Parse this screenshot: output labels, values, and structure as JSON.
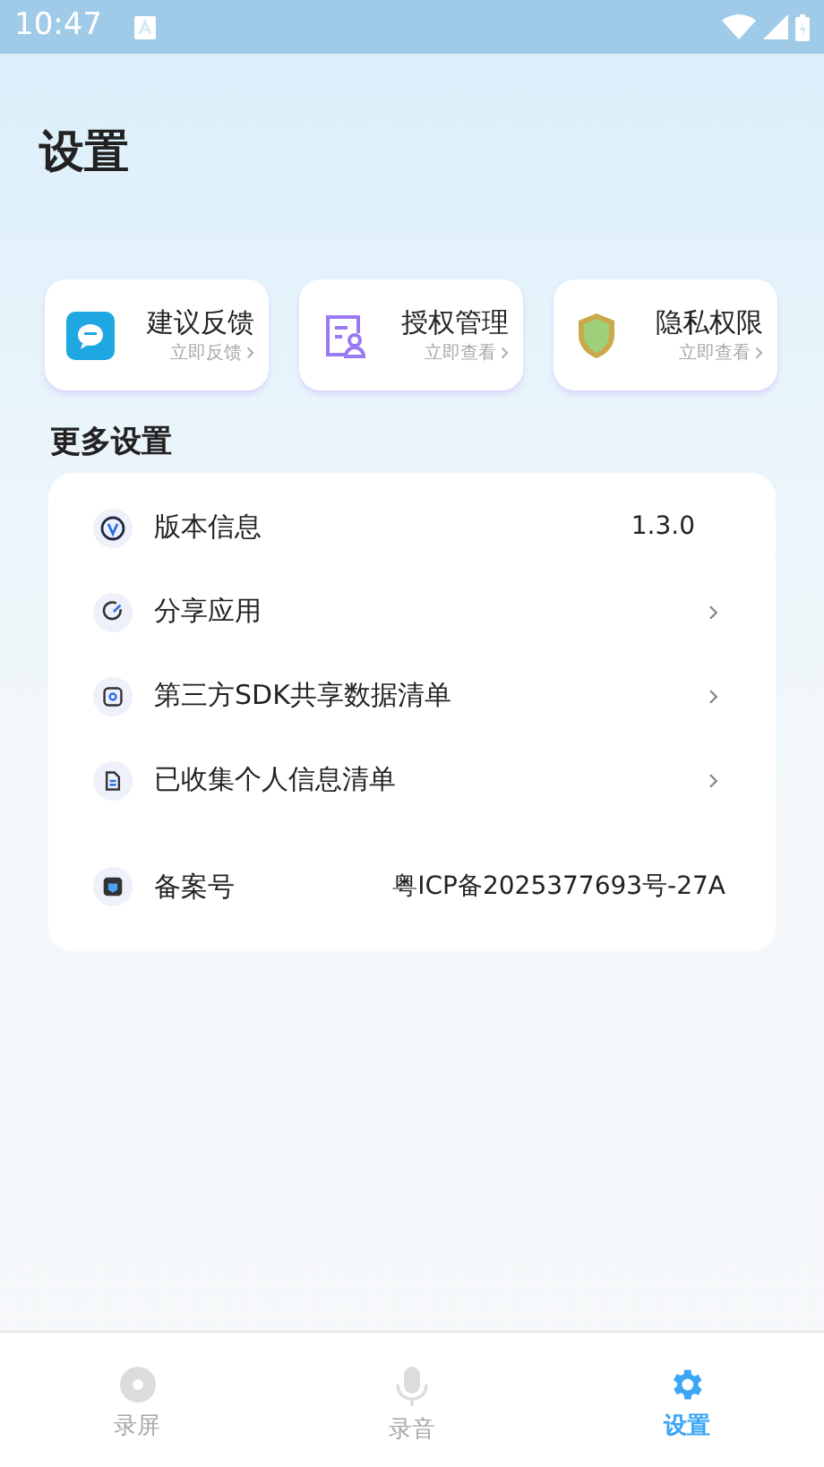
{
  "status_bar": {
    "time": "10:47"
  },
  "title": "设置",
  "quick_cards": [
    {
      "kind": "feedback",
      "title": "建议反馈",
      "action": "立即反馈"
    },
    {
      "kind": "auth",
      "title": "授权管理",
      "action": "立即查看"
    },
    {
      "kind": "privacy",
      "title": "隐私权限",
      "action": "立即查看"
    }
  ],
  "section_title": "更多设置",
  "settings": [
    {
      "kind": "value",
      "label": "版本信息",
      "value": "1.3.0"
    },
    {
      "kind": "link",
      "label": "分享应用"
    },
    {
      "kind": "link",
      "label": "第三方SDK共享数据清单"
    },
    {
      "kind": "link",
      "label": "已收集个人信息清单"
    },
    {
      "kind": "value",
      "label": "备案号",
      "value": "粤ICP备2025377693号-27A"
    }
  ],
  "nav": [
    {
      "label": "录屏",
      "selected": false
    },
    {
      "label": "录音",
      "selected": false
    },
    {
      "label": "设置",
      "selected": true
    }
  ]
}
